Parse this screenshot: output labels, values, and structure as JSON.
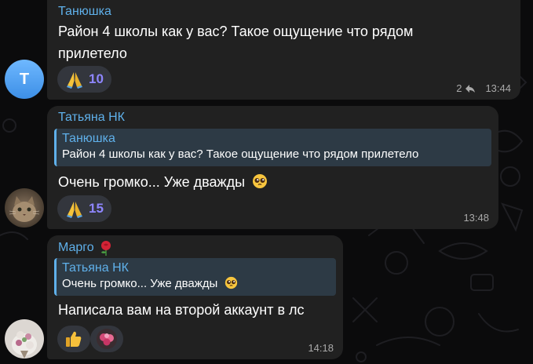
{
  "messages": [
    {
      "sender": "Танюшка",
      "avatar_letter": "T",
      "text_lines": [
        "Район 4 школы как у вас? Такое ощущение что рядом",
        "прилетело"
      ],
      "reactions": [
        {
          "icon": "praying-hands-icon",
          "count": "10"
        }
      ],
      "replies": "2",
      "time": "13:44"
    },
    {
      "sender": "Татьяна НК",
      "avatar": "cat-photo",
      "quote": {
        "author": "Танюшка",
        "text": "Район 4 школы как у вас? Такое ощущение что рядом прилетело"
      },
      "text": "Очень громко... Уже дважды",
      "reactions": [
        {
          "icon": "praying-hands-icon",
          "count": "15"
        }
      ],
      "time": "13:48"
    },
    {
      "sender": "Марго",
      "sender_emoji": "rose-icon",
      "avatar": "flowers-photo",
      "quote": {
        "author": "Татьяна НК",
        "text": "Очень громко... Уже дважды"
      },
      "text": "Написала вам на второй аккаунт в лс",
      "reactions": [
        {
          "icon": "thumbs-up-icon"
        },
        {
          "icon": "reactor-avatar-flowers"
        }
      ],
      "time": "14:18"
    }
  ],
  "colors": {
    "background": "#0b0b0c",
    "bubble": "#212121",
    "accent_name": "#5fb0ea",
    "quote_bg": "#2d3a45",
    "reaction_bg": "#33363d",
    "reaction_count": "#8e86ff",
    "meta": "#a9a9a9"
  }
}
